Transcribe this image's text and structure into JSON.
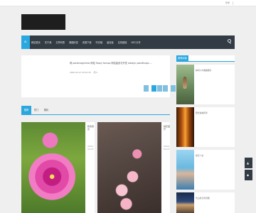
{
  "topbar": {
    "link": "登录"
  },
  "nav": {
    "home_icon": "home-icon",
    "items": [
      "网站首页",
      "关于我",
      "文章列表",
      "美图欣赏",
      "资源下载",
      "时光轴",
      "留言板",
      "友情链接",
      "DEC分享"
    ]
  },
  "notice": {
    "headline": "网 pandivaginimsi 网站 fiopry fonsps 网站建设与开发 olaleyn panditcaps ...",
    "date": "2020-04-27 00:32:30",
    "views": "阅 5"
  },
  "tabs": [
    "推荐",
    "热门",
    "随机"
  ],
  "cards": [
    {
      "title": "粉色菊花",
      "date": "2020-04-27"
    },
    {
      "title": "桃花盛开",
      "date": "2020-04-27"
    }
  ],
  "sidebar": {
    "heading": "推荐阅读",
    "items": [
      {
        "title": "林间小鸟唯美图片"
      },
      {
        "title": "阳光森林风景"
      },
      {
        "title": "夏日少女"
      },
      {
        "title": "雪山星空风景图"
      }
    ]
  },
  "float_buttons": [
    "回顶部",
    "微信"
  ]
}
